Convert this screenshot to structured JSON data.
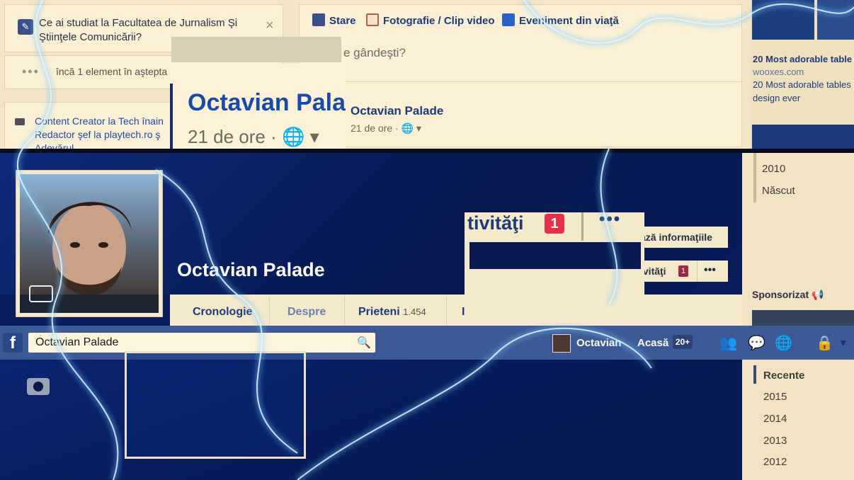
{
  "notice": {
    "text": "Ce ai studiat la Facultatea de Jurnalism Şi Ştiinţele Comunicării?",
    "close": "×"
  },
  "pending": {
    "dots": "•••",
    "text": "încă 1 element în aştepta"
  },
  "work": {
    "line1": "Content Creator la Tech înain",
    "line2": "Redactor şef la playtech.ro ş",
    "line3": "Adevărul"
  },
  "composer": {
    "tabs": [
      "Stare",
      "Fotografie / Clip video",
      "Eveniment din viaţă"
    ],
    "prompt": "e gândeşti?",
    "post_name": "Octavian Palade",
    "post_time": "21 de ore · 🌐 ▾"
  },
  "zoom": {
    "name": "Octavian Pala",
    "time": "21 de ore · 🌐 ▾"
  },
  "right_ad": {
    "link1": "20 Most adorable table",
    "domain": "wooxes.com",
    "link2": "20 Most adorable tables",
    "link2b": "design ever"
  },
  "profile": {
    "name": "Octavian Palade",
    "tabs": [
      {
        "label": "Cronologie"
      },
      {
        "label": "Despre"
      },
      {
        "label": "Prieteni",
        "count": "1.454"
      },
      {
        "label": "I"
      }
    ]
  },
  "activity_popup": {
    "label": "tivităţi",
    "badge": "1",
    "more": "•••"
  },
  "buttons": {
    "update_info": "ază informaţiile",
    "activity": "ivităţi",
    "activity_badge": "1",
    "more": "•••"
  },
  "timeline_mid": {
    "years": [
      "2010",
      "Născut"
    ],
    "sponsored": "Sponsorizat"
  },
  "topbar": {
    "logo": "f",
    "search_value": "Octavian Palade",
    "user": "Octavian",
    "home": "Acasă",
    "home_count": "20+"
  },
  "timeline_bottom": {
    "selected": "Recente",
    "years": [
      "2015",
      "2014",
      "2013",
      "2012"
    ]
  },
  "colors": {
    "brand_blue": "#3d5a96",
    "badge_red": "#e6304a",
    "cream": "#f5e9cc",
    "link_blue": "#1f3a78"
  }
}
